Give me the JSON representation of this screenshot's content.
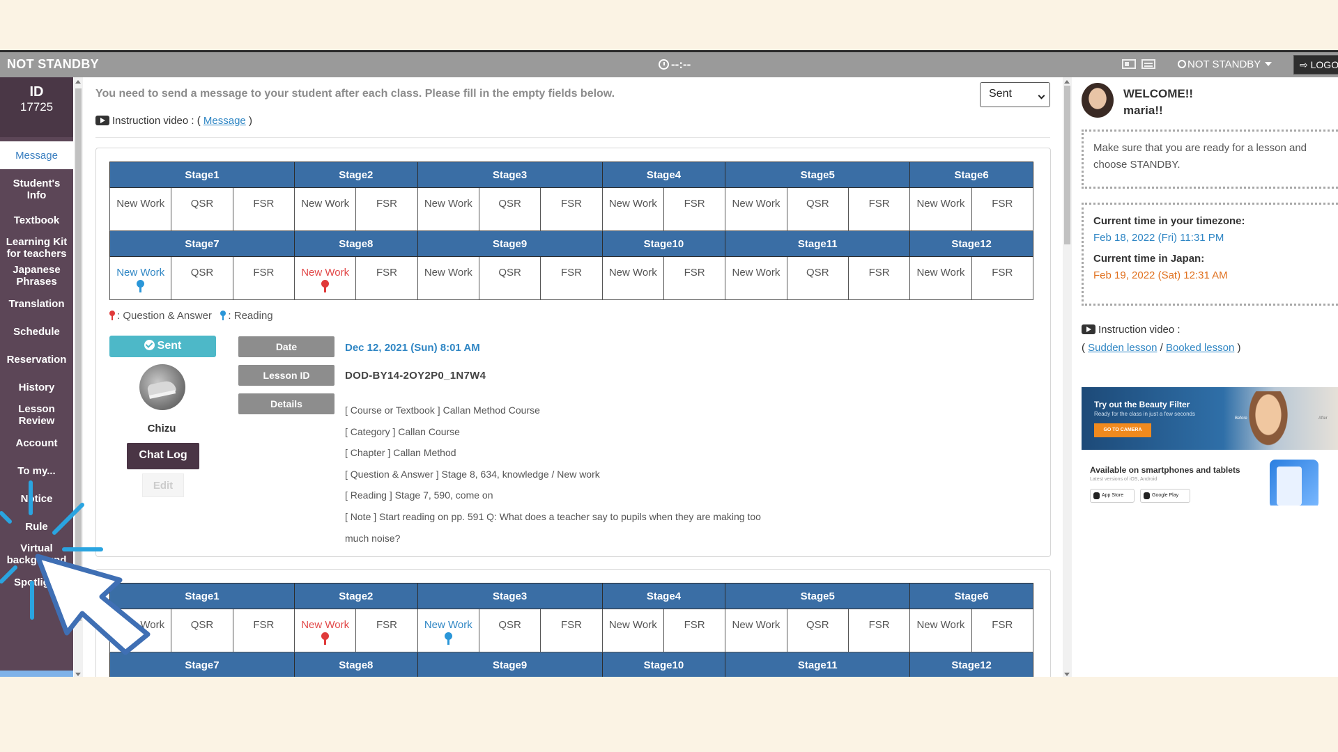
{
  "topbar": {
    "status": "NOT STANDBY",
    "timer": "--:--",
    "standby_dropdown": "NOT STANDBY",
    "logout": "LOGO"
  },
  "sidebar": {
    "id_label": "ID",
    "id_value": "17725",
    "items": [
      {
        "label": "Message",
        "active": true
      },
      {
        "label": "Student's Info"
      },
      {
        "label": "Textbook"
      },
      {
        "label": "Learning Kit for teachers"
      },
      {
        "label": "Japanese Phrases"
      },
      {
        "label": "Translation"
      },
      {
        "label": "Schedule"
      },
      {
        "label": "Reservation"
      },
      {
        "label": "History"
      },
      {
        "label": "Lesson Review"
      },
      {
        "label": "Account"
      },
      {
        "label": "To my..."
      },
      {
        "label": "Notice"
      },
      {
        "label": "Rule"
      },
      {
        "label": "Virtual background"
      },
      {
        "label": "Spotlight"
      }
    ]
  },
  "main": {
    "notice": "You need to send a message to your student after each class. Please fill in the empty fields below.",
    "filter_select": "Sent",
    "instruction_prefix": "Instruction video : (",
    "instruction_link": "Message",
    "instruction_suffix": ")",
    "legend_qa": ": Question & Answer",
    "legend_reading": ": Reading",
    "card1": {
      "stage_row1": [
        "Stage1",
        "Stage2",
        "Stage3",
        "Stage4",
        "Stage5",
        "Stage6"
      ],
      "stage_row2": [
        "Stage7",
        "Stage8",
        "Stage9",
        "Stage10",
        "Stage11",
        "Stage12"
      ],
      "sent_badge": "Sent",
      "student_name": "Chizu",
      "chat_log": "Chat Log",
      "edit": "Edit",
      "date_label": "Date",
      "date_value": "Dec 12, 2021 (Sun) 8:01 AM",
      "lesson_label": "Lesson ID",
      "lesson_value": "DOD-BY14-2OY2P0_1N7W4",
      "details_label": "Details",
      "details": [
        "[ Course or Textbook ] Callan Method Course",
        "[ Category ] Callan Course",
        "[ Chapter ] Callan Method",
        "[ Question & Answer ] Stage 8, 634, knowledge / New work",
        "[ Reading ] Stage 7, 590, come on",
        "[ Note ] Start reading on pp. 591 Q: What does a teacher say to pupils when they are making too",
        "much noise?"
      ]
    },
    "card2": {
      "stage_row1": [
        "Stage1",
        "Stage2",
        "Stage3",
        "Stage4",
        "Stage5",
        "Stage6"
      ],
      "stage_row2": [
        "Stage7",
        "Stage8",
        "Stage9",
        "Stage10",
        "Stage11",
        "Stage12"
      ]
    },
    "cell_labels": {
      "new_work": "New Work",
      "qsr": "QSR",
      "fsr": "FSR"
    }
  },
  "right": {
    "welcome": "WELCOME!!",
    "username": "maria!!",
    "ready_msg": "Make sure that you are ready for a lesson and choose STANDBY.",
    "tz_head": "Current time in your timezone:",
    "tz_value": "Feb 18, 2022 (Fri) 11:31 PM",
    "jp_head": "Current time in Japan:",
    "jp_value": "Feb 19, 2022 (Sat) 12:31 AM",
    "instr_label": "Instruction video :",
    "sudden_link": "Sudden lesson",
    "booked_link": "Booked lesson",
    "banner1_title": "Try out the Beauty Filter",
    "banner1_sub": "Ready for the class in just a few seconds",
    "banner1_btn": "GO TO CAMERA",
    "banner1_before": "Before",
    "banner1_after": "After",
    "banner2_title": "Available on smartphones and tablets",
    "banner2_sub": "Latest versions of iOS, Android",
    "appstore": "App Store",
    "gplay": "Google Play"
  },
  "colors": {
    "stage_header": "#3a6ea5",
    "sidebar": "#5c4657",
    "sent_badge": "#4db8c8",
    "link": "#2f86c4",
    "japan_time": "#e0701e",
    "cursor_outline": "#3f6fb4"
  }
}
